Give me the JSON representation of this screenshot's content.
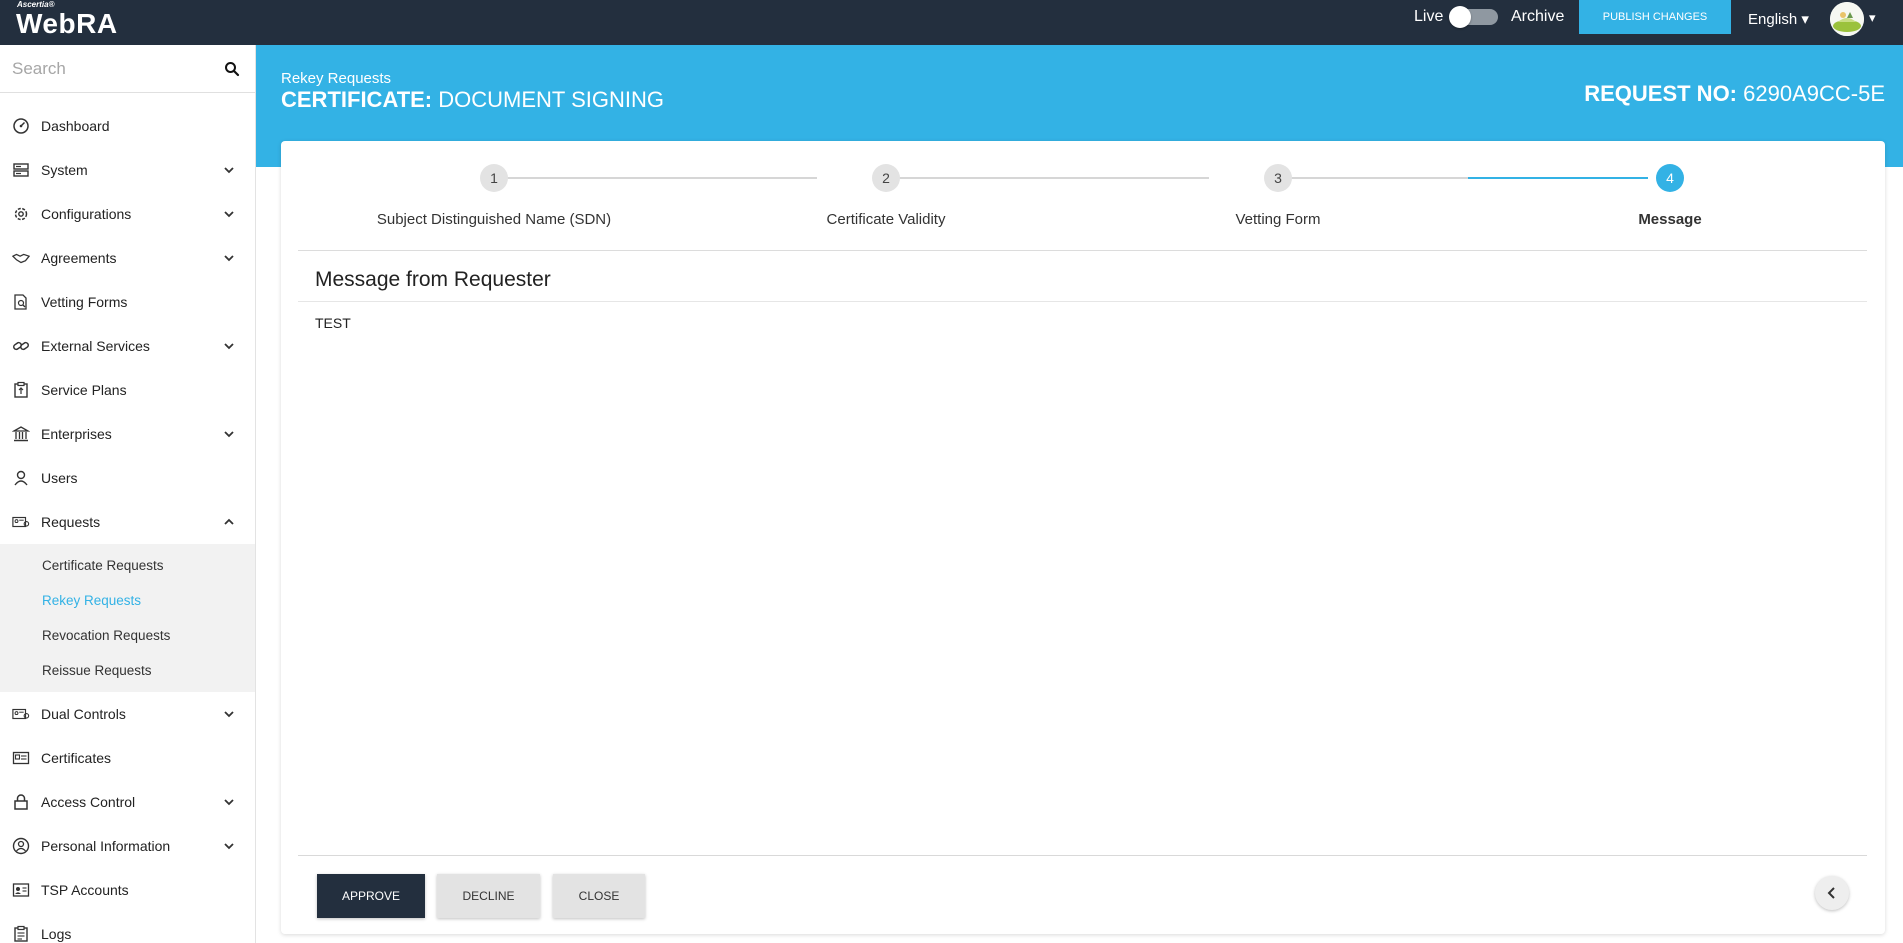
{
  "topbar": {
    "logo_small": "Ascertia®",
    "logo_main": "WebRA",
    "live_label": "Live",
    "archive_label": "Archive",
    "publish_label": "PUBLISH CHANGES",
    "language": "English ▾",
    "avatar_caret": "▾"
  },
  "sidebar": {
    "search_placeholder": "Search",
    "items": [
      {
        "label": "Dashboard",
        "icon": "dashboard-icon",
        "expandable": false
      },
      {
        "label": "System",
        "icon": "server-icon",
        "expandable": true
      },
      {
        "label": "Configurations",
        "icon": "gear-icon",
        "expandable": true
      },
      {
        "label": "Agreements",
        "icon": "handshake-icon",
        "expandable": true
      },
      {
        "label": "Vetting Forms",
        "icon": "document-search-icon",
        "expandable": false
      },
      {
        "label": "External Services",
        "icon": "link-icon",
        "expandable": true
      },
      {
        "label": "Service Plans",
        "icon": "clipboard-icon",
        "expandable": false
      },
      {
        "label": "Enterprises",
        "icon": "bank-icon",
        "expandable": true
      },
      {
        "label": "Users",
        "icon": "user-icon",
        "expandable": false
      },
      {
        "label": "Requests",
        "icon": "id-card-icon",
        "expandable": true,
        "expanded": true
      }
    ],
    "request_subitems": [
      {
        "label": "Certificate Requests",
        "active": false
      },
      {
        "label": "Rekey Requests",
        "active": true
      },
      {
        "label": "Revocation Requests",
        "active": false
      },
      {
        "label": "Reissue Requests",
        "active": false
      }
    ],
    "items_after": [
      {
        "label": "Dual Controls",
        "icon": "id-card-icon",
        "expandable": true
      },
      {
        "label": "Certificates",
        "icon": "certificate-icon",
        "expandable": false
      },
      {
        "label": "Access Control",
        "icon": "lock-icon",
        "expandable": true
      },
      {
        "label": "Personal Information",
        "icon": "user-circle-icon",
        "expandable": true
      },
      {
        "label": "TSP Accounts",
        "icon": "badge-icon",
        "expandable": false
      },
      {
        "label": "Logs",
        "icon": "log-icon",
        "expandable": false
      }
    ]
  },
  "header": {
    "subtitle": "Rekey Requests",
    "title_bold": "CERTIFICATE:",
    "title_rest": " DOCUMENT SIGNING",
    "request_label": "REQUEST NO:",
    "request_no": " 6290A9CC-5E"
  },
  "stepper": {
    "steps": [
      {
        "number": "1",
        "label": "Subject Distinguished Name (SDN)"
      },
      {
        "number": "2",
        "label": "Certificate Validity"
      },
      {
        "number": "3",
        "label": "Vetting Form"
      },
      {
        "number": "4",
        "label": "Message"
      }
    ],
    "active_step": 4
  },
  "message": {
    "title": "Message from Requester",
    "body": "TEST"
  },
  "actions": {
    "approve": "APPROVE",
    "decline": "DECLINE",
    "close": "CLOSE"
  },
  "colors": {
    "accent": "#33b2e5",
    "dark": "#232f3e"
  }
}
